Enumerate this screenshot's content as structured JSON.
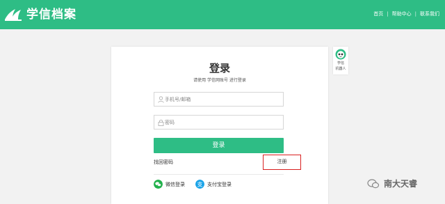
{
  "header": {
    "logo_text": "学信档案",
    "nav": [
      "首页",
      "帮助中心",
      "联系我们"
    ],
    "bg_color": "#2ebd85"
  },
  "login": {
    "title": "登录",
    "subtitle": "请使用 学信网账号 进行登录",
    "phone_placeholder": "手机号/邮箱",
    "password_placeholder": "密码",
    "button_label": "登录",
    "find_password": "找回密码",
    "register": "注册",
    "wechat_login": "微信登录",
    "alipay_login": "支付宝登录"
  },
  "robot": {
    "line1": "学信",
    "line2": "机器人"
  },
  "watermark": "南大天睿",
  "icons": {
    "user": "user-icon",
    "lock": "lock-icon",
    "wechat": "wechat-icon",
    "alipay": "alipay-icon",
    "robot": "robot-icon"
  },
  "colors": {
    "accent": "#2ebd85",
    "highlight_border": "#d81f1f",
    "wechat": "#23b14d",
    "alipay": "#1aa3e8"
  }
}
